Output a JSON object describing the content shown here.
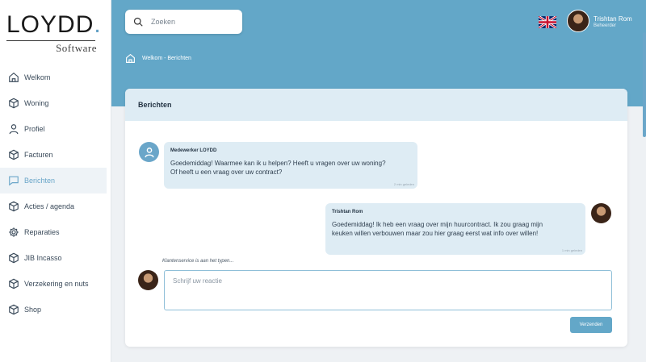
{
  "brand": {
    "logo_main": "LOYDD",
    "logo_dot": ".",
    "logo_sub": "Software",
    "accent": "#5f9fc4"
  },
  "sidebar": {
    "items": [
      {
        "label": "Welkom",
        "icon": "home-icon"
      },
      {
        "label": "Woning",
        "icon": "box-icon"
      },
      {
        "label": "Profiel",
        "icon": "user-icon"
      },
      {
        "label": "Facturen",
        "icon": "box-icon"
      },
      {
        "label": "Berichten",
        "icon": "message-icon",
        "active": true
      },
      {
        "label": "Acties / agenda",
        "icon": "box-icon"
      },
      {
        "label": "Reparaties",
        "icon": "gear-icon"
      },
      {
        "label": "JIB Incasso",
        "icon": "box-icon"
      },
      {
        "label": "Verzekering en nuts",
        "icon": "box-icon"
      },
      {
        "label": "Shop",
        "icon": "box-icon"
      }
    ]
  },
  "header": {
    "search_placeholder": "Zoeken",
    "language_flag": "uk-flag-icon",
    "user": {
      "name": "Trishtan Rom",
      "role": "Beheerder"
    },
    "breadcrumb": "Welkom - Berichten",
    "band_color": "#63a7c8"
  },
  "messages": {
    "title": "Berichten",
    "items": [
      {
        "sender": "Medewerker LOYDD",
        "text_line1": "Goedemiddag! Waarmee kan ik u helpen? Heeft u vragen over uw woning?",
        "text_line2": "Of heeft u een vraag over uw contract?",
        "time": "2 min geleden"
      },
      {
        "sender": "Trishtan Rom",
        "text_line1": "Goedemiddag! Ik heb een vraag over mijn huurcontract. Ik zou graag mijn",
        "text_line2": "keuken willen verbouwen maar zou hier graag eerst wat info over willen!",
        "time": "1 min geleden"
      }
    ],
    "typing_indicator": "Klantenservice is aan het typen...",
    "compose_placeholder": "Schrijf uw reactie",
    "send_label": "Verzenden"
  }
}
